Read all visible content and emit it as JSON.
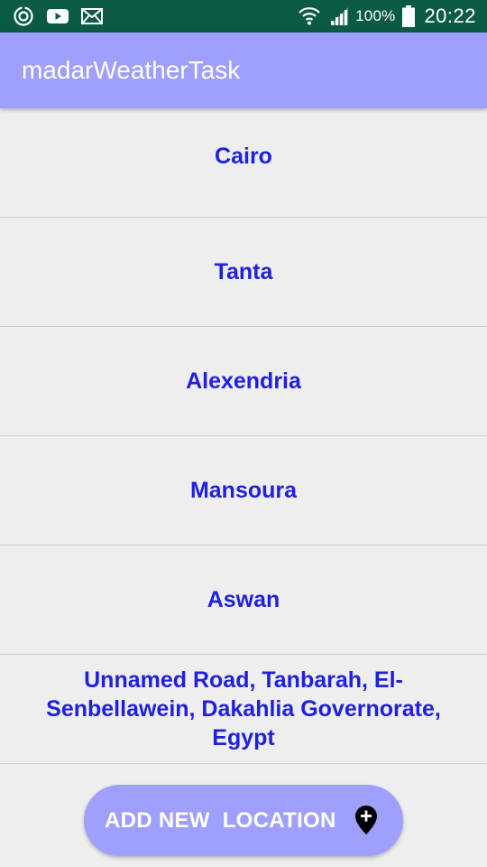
{
  "status_bar": {
    "left_icons": [
      "sync-icon",
      "youtube-icon",
      "mail-icon"
    ],
    "right_icons": [
      "wifi-icon",
      "signal-icon",
      "battery-icon"
    ],
    "battery": "100%",
    "time": "20:22"
  },
  "app_bar": {
    "title": "madarWeatherTask"
  },
  "locations": [
    {
      "name": "Cairo"
    },
    {
      "name": "Tanta"
    },
    {
      "name": "Alexendria"
    },
    {
      "name": "Mansoura"
    },
    {
      "name": "Aswan"
    },
    {
      "name": "Unnamed Road, Tanbarah, El-Senbellawein, Dakahlia Governorate, Egypt"
    }
  ],
  "add_button": {
    "label": "ADD NEW  LOCATION",
    "icon": "add-location-pin-icon"
  },
  "colors": {
    "status_bar_bg": "#0b5a45",
    "app_bar_bg": "#9f9fff",
    "list_text": "#2020dd",
    "background": "#eeeeee",
    "divider": "#cfcfcf"
  }
}
